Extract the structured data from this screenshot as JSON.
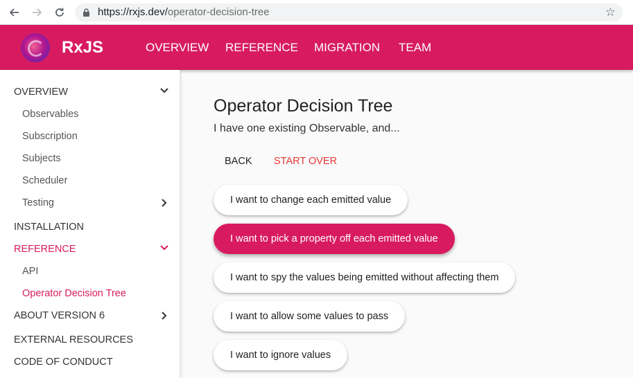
{
  "browser": {
    "url_host": "https://rxjs.dev/",
    "url_path": "operator-decision-tree"
  },
  "topnav": {
    "brand": "RxJS",
    "items": [
      "OVERVIEW",
      "REFERENCE",
      "MIGRATION",
      "TEAM"
    ]
  },
  "sidebar": {
    "items": [
      {
        "label": "OVERVIEW",
        "expanded": true
      },
      {
        "label": "Observables"
      },
      {
        "label": "Subscription"
      },
      {
        "label": "Subjects"
      },
      {
        "label": "Scheduler"
      },
      {
        "label": "Testing",
        "expanded": false
      },
      {
        "label": "INSTALLATION"
      },
      {
        "label": "REFERENCE",
        "expanded": true,
        "active": true
      },
      {
        "label": "API"
      },
      {
        "label": "Operator Decision Tree",
        "active": true
      },
      {
        "label": "ABOUT VERSION 6",
        "expanded": false
      },
      {
        "label": "EXTERNAL RESOURCES"
      },
      {
        "label": "CODE OF CONDUCT"
      }
    ]
  },
  "main": {
    "title": "Operator Decision Tree",
    "subtitle": "I have one existing Observable, and...",
    "back_label": "BACK",
    "start_over_label": "START OVER",
    "options": [
      {
        "label": "I want to change each emitted value"
      },
      {
        "label": "I want to pick a property off each emitted value",
        "selected": true
      },
      {
        "label": "I want to spy the values being emitted without affecting them"
      },
      {
        "label": "I want to allow some values to pass"
      },
      {
        "label": "I want to ignore values"
      }
    ]
  },
  "colors": {
    "brand": "#d81b60",
    "start_over": "#e53935"
  }
}
